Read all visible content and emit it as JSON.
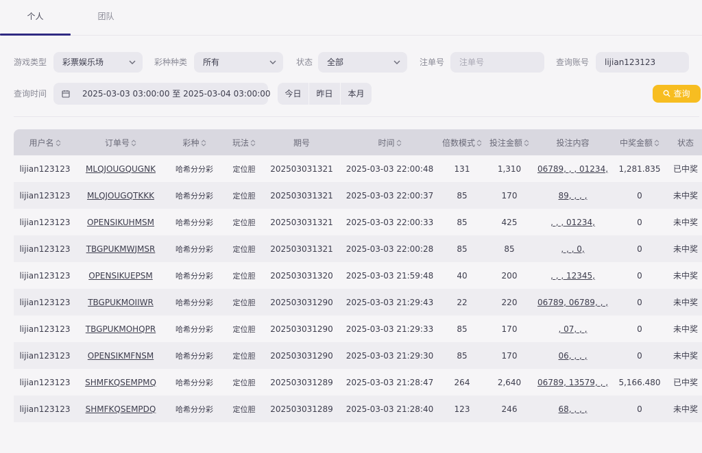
{
  "tabs": [
    {
      "label": "个人",
      "active": true
    },
    {
      "label": "团队",
      "active": false
    }
  ],
  "filters": {
    "game_type": {
      "label": "游戏类型",
      "value": "彩票娱乐场"
    },
    "lottery_kind": {
      "label": "彩种种类",
      "value": "所有"
    },
    "status": {
      "label": "状态",
      "value": "全部"
    },
    "order_no": {
      "label": "注单号",
      "placeholder": "注单号"
    },
    "query_account": {
      "label": "查询账号",
      "value": "lijian123123"
    },
    "query_time": {
      "label": "查询时间",
      "range": "2025-03-03 03:00:00 至 2025-03-04 03:00:00"
    },
    "quick": [
      "今日",
      "昨日",
      "本月"
    ],
    "search_label": "查询"
  },
  "table": {
    "columns": [
      "用户名",
      "订单号",
      "彩种",
      "玩法",
      "期号",
      "时间",
      "倍数模式",
      "投注金额",
      "投注内容",
      "中奖金额",
      "状态"
    ],
    "rows": [
      [
        "lijian123123",
        "MLQJOUGQUGNK",
        "哈希分分彩",
        "定位胆",
        "202503031321",
        "2025-03-03 22:00:48",
        "131",
        "1,310",
        "06789, , , 01234,",
        "1,281.835",
        "已中奖"
      ],
      [
        "lijian123123",
        "MLQJOUGQTKKK",
        "哈希分分彩",
        "定位胆",
        "202503031321",
        "2025-03-03 22:00:37",
        "85",
        "170",
        "89, , , ,",
        "0",
        "未中奖"
      ],
      [
        "lijian123123",
        "OPENSIKUHMSM",
        "哈希分分彩",
        "定位胆",
        "202503031321",
        "2025-03-03 22:00:33",
        "85",
        "425",
        ", , , 01234,",
        "0",
        "未中奖"
      ],
      [
        "lijian123123",
        "TBGPUKMWJMSR",
        "哈希分分彩",
        "定位胆",
        "202503031321",
        "2025-03-03 22:00:28",
        "85",
        "85",
        ", , , 0,",
        "0",
        "未中奖"
      ],
      [
        "lijian123123",
        "OPENSIKUEPSM",
        "哈希分分彩",
        "定位胆",
        "202503031320",
        "2025-03-03 21:59:48",
        "40",
        "200",
        ", , , 12345,",
        "0",
        "未中奖"
      ],
      [
        "lijian123123",
        "TBGPUKMOIIWR",
        "哈希分分彩",
        "定位胆",
        "202503031290",
        "2025-03-03 21:29:43",
        "22",
        "220",
        "06789, 06789, , ,",
        "0",
        "未中奖"
      ],
      [
        "lijian123123",
        "TBGPUKMOHQPR",
        "哈希分分彩",
        "定位胆",
        "202503031290",
        "2025-03-03 21:29:33",
        "85",
        "170",
        ", 07, , ,",
        "0",
        "未中奖"
      ],
      [
        "lijian123123",
        "OPENSIKMFNSM",
        "哈希分分彩",
        "定位胆",
        "202503031290",
        "2025-03-03 21:29:30",
        "85",
        "170",
        "06, , , ,",
        "0",
        "未中奖"
      ],
      [
        "lijian123123",
        "SHMFKQSEMPMQ",
        "哈希分分彩",
        "定位胆",
        "202503031289",
        "2025-03-03 21:28:47",
        "264",
        "2,640",
        "06789, 13579, , ,",
        "5,166.480",
        "已中奖"
      ],
      [
        "lijian123123",
        "SHMFKQSEMPDQ",
        "哈希分分彩",
        "定位胆",
        "202503031289",
        "2025-03-03 21:28:40",
        "123",
        "246",
        "68, , , ,",
        "0",
        "未中奖"
      ]
    ]
  },
  "colors": {
    "accent": "#2f2a82",
    "search_button": "#f7bd21"
  }
}
